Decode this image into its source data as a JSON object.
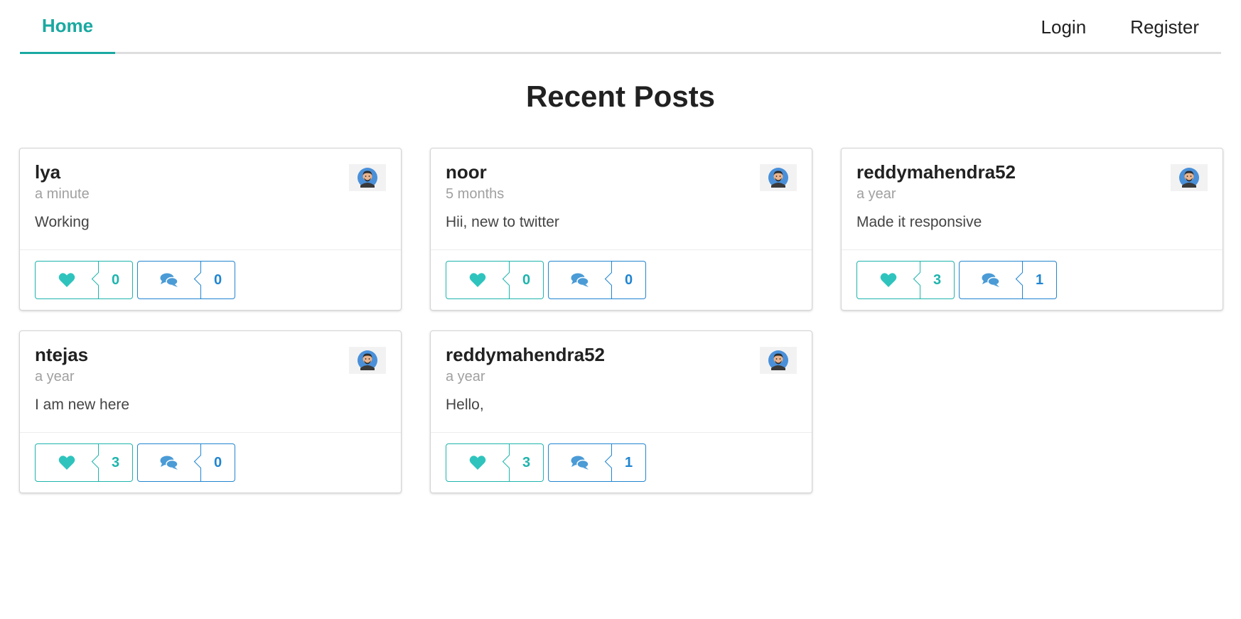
{
  "nav": {
    "home": "Home",
    "login": "Login",
    "register": "Register"
  },
  "page": {
    "title": "Recent Posts"
  },
  "posts": [
    {
      "user": "lya",
      "time": "a minute",
      "body": "Working",
      "likes": "0",
      "comments": "0"
    },
    {
      "user": "noor",
      "time": "5 months",
      "body": "Hii, new to twitter",
      "likes": "0",
      "comments": "0"
    },
    {
      "user": "reddymahendra52",
      "time": "a year",
      "body": "Made it responsive",
      "likes": "3",
      "comments": "1"
    },
    {
      "user": "ntejas",
      "time": "a year",
      "body": "I am new here",
      "likes": "3",
      "comments": "0"
    },
    {
      "user": "reddymahendra52",
      "time": "a year",
      "body": "Hello,",
      "likes": "3",
      "comments": "1"
    }
  ],
  "colors": {
    "accent": "#1aa9a1",
    "like": "#1eb4ad",
    "comment": "#2185d0"
  },
  "icons": {
    "like": "heart-icon",
    "comment": "comments-icon",
    "avatar": "user-avatar"
  }
}
